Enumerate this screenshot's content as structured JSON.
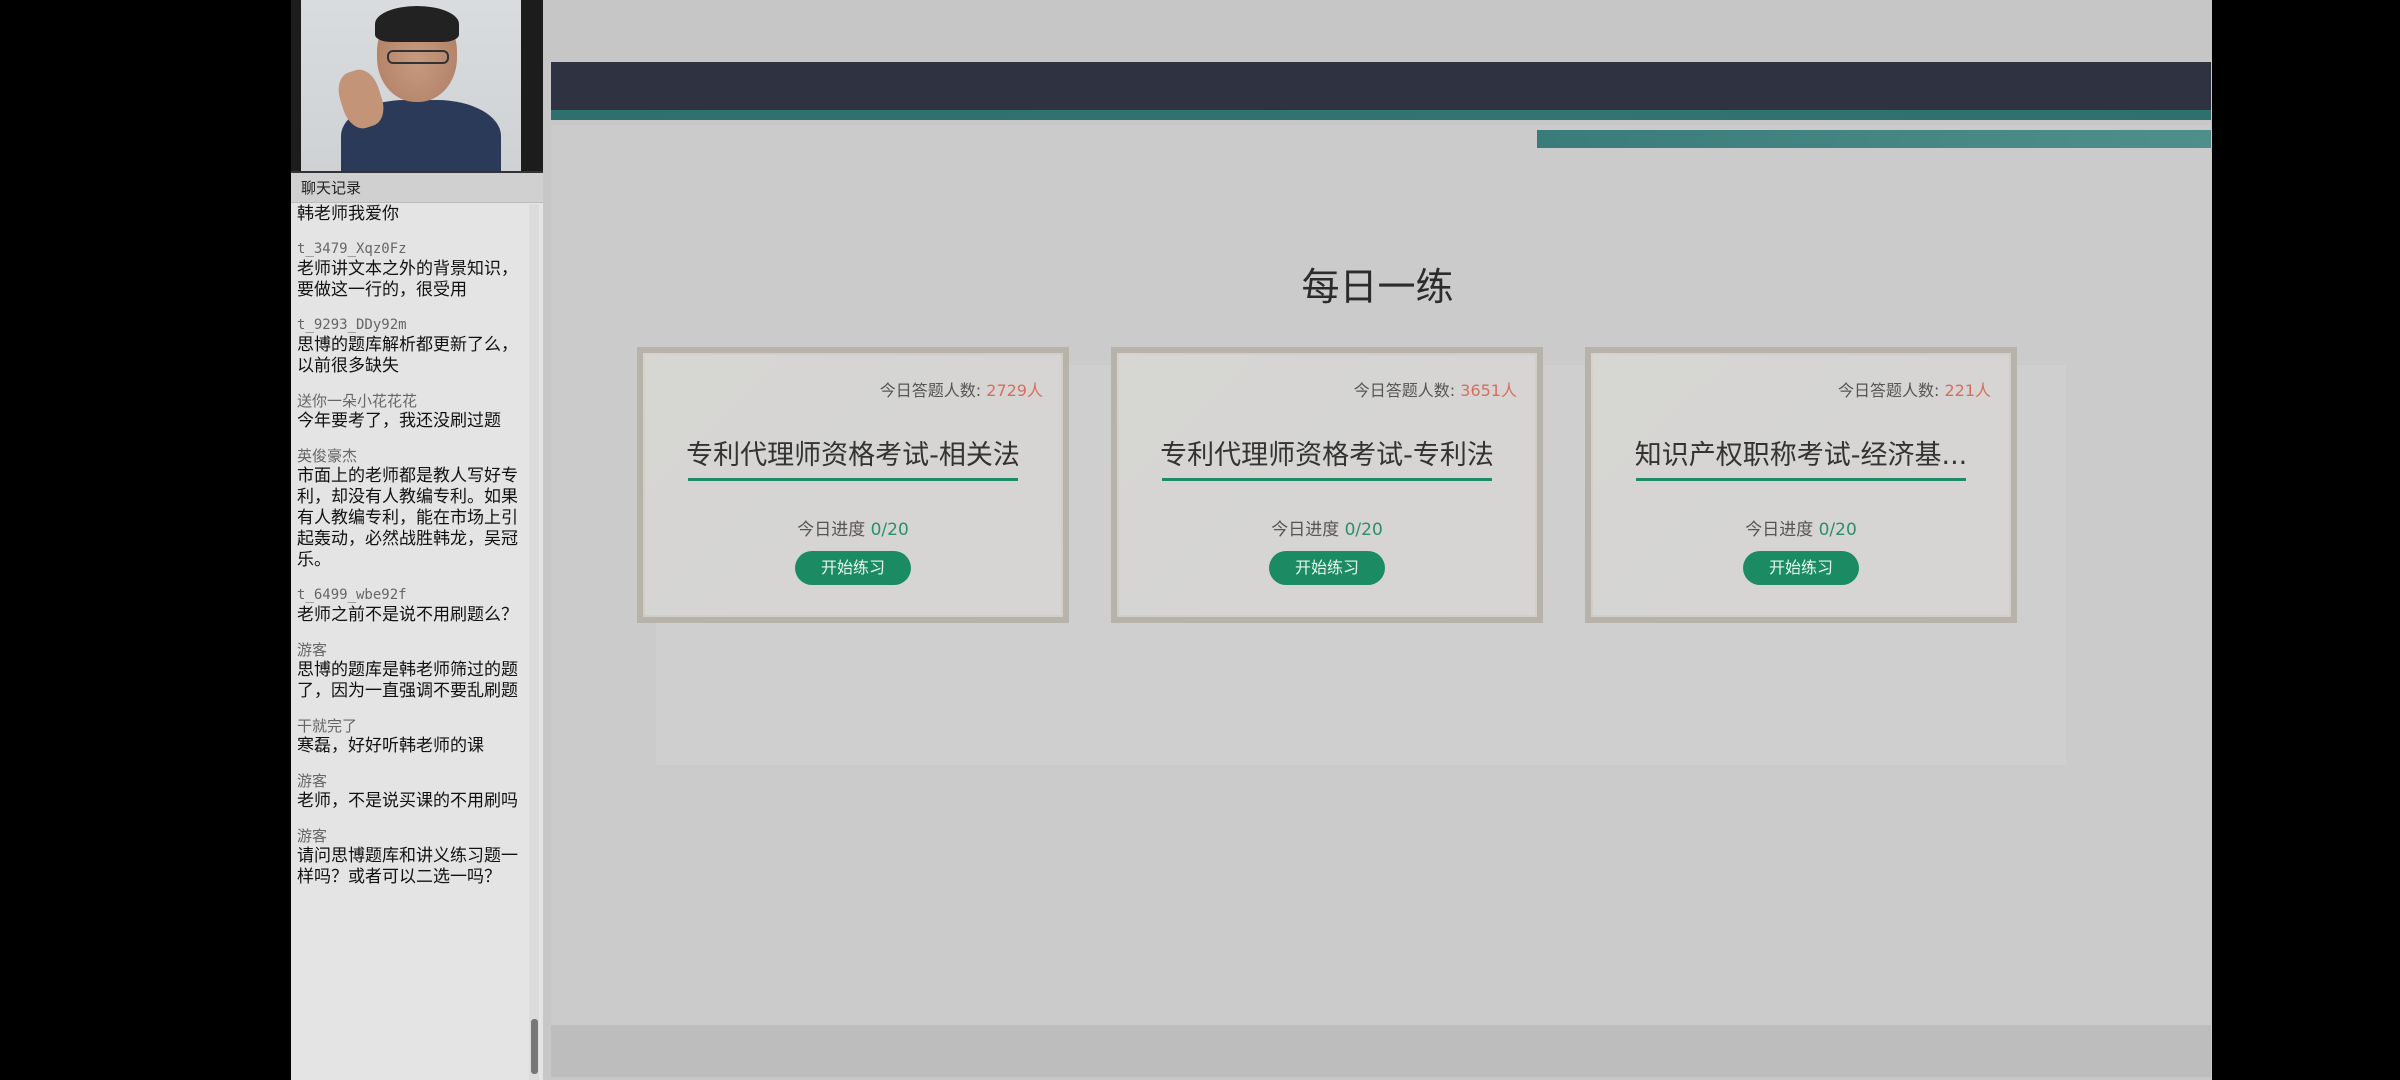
{
  "chat": {
    "header": "聊天记录",
    "messages": [
      {
        "name": "",
        "text": "韩老师我爱你"
      },
      {
        "name": "t_3479_Xqz0Fz",
        "text": "老师讲文本之外的背景知识，要做这一行的，很受用"
      },
      {
        "name": "t_9293_DDy92m",
        "text": "思博的题库解析都更新了么，以前很多缺失"
      },
      {
        "name": "送你一朵小花花花",
        "text": "今年要考了，我还没刷过题"
      },
      {
        "name": "英俊豪杰",
        "text": "市面上的老师都是教人写好专利，却没有人教编专利。如果有人教编专利，能在市场上引起轰动，必然战胜韩龙，吴冠乐。"
      },
      {
        "name": "t_6499_wbe92f",
        "text": "老师之前不是说不用刷题么？"
      },
      {
        "name": "游客",
        "text": "思博的题库是韩老师筛过的题了，因为一直强调不要乱刷题"
      },
      {
        "name": "干就完了",
        "text": "寒磊，好好听韩老师的课"
      },
      {
        "name": "游客",
        "text": "老师，不是说买课的不用刷吗"
      },
      {
        "name": "游客",
        "text": "请问思博题库和讲义练习题一样吗？或者可以二选一吗？"
      }
    ]
  },
  "main": {
    "section_title": "每日一练",
    "count_label": "今日答题人数:",
    "progress_label": "今日进度",
    "cards": [
      {
        "count": "2729人",
        "title": "专利代理师资格考试-相关法",
        "progress": "0/20",
        "button": "开始练习"
      },
      {
        "count": "3651人",
        "title": "专利代理师资格考试-专利法",
        "progress": "0/20",
        "button": "开始练习"
      },
      {
        "count": "221人",
        "title": "知识产权职称考试-经济基...",
        "progress": "0/20",
        "button": "开始练习"
      }
    ]
  },
  "colors": {
    "banner": "#2f3240",
    "accent_teal": "#2f6f6e",
    "button_green": "#1a8b63",
    "count_red": "#d46f5f"
  }
}
